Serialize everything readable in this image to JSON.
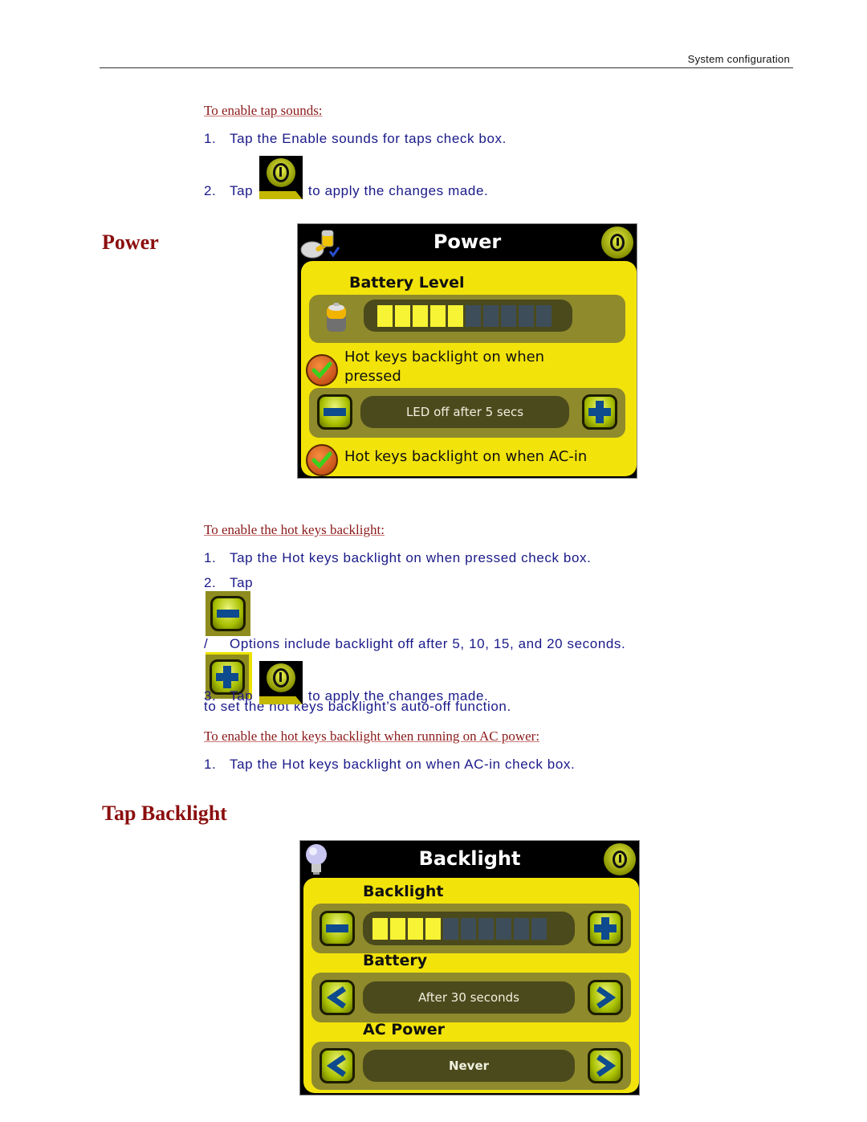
{
  "header": {
    "running_head": "System configuration"
  },
  "tap_sounds": {
    "subheading": "To enable tap sounds:",
    "steps": [
      {
        "num": "1.",
        "text": "Tap the Enable sounds for taps check box."
      },
      {
        "num": "2.",
        "pre": "Tap",
        "post": "to apply the changes made."
      }
    ]
  },
  "power_section": {
    "heading": "Power",
    "panel": {
      "title": "Power",
      "header_icon": "battery-plug-icon",
      "ok_icon": "power-ok-icon",
      "battery_level_label": "Battery Level",
      "battery_level": {
        "filled_segments": 5,
        "total_segments": 10
      },
      "hotkeys_pressed": {
        "label_line1": "Hot keys backlight on when",
        "label_line2": "pressed",
        "checked": true
      },
      "led_value": "LED off after 5 secs",
      "hotkeys_ac": {
        "label": "Hot keys backlight on when AC-in",
        "checked": true
      }
    }
  },
  "hotkeys": {
    "subheading": "To enable the hot keys backlight:",
    "steps": [
      {
        "num": "1.",
        "text": "Tap the Hot keys backlight on when pressed check box."
      },
      {
        "num": "2.",
        "pre": "Tap",
        "sep": "/",
        "post": "to set the hot keys backlight’s auto-off function.",
        "cont": "Options include backlight off after 5, 10, 15, and 20 seconds."
      },
      {
        "num": "3.",
        "pre": "Tap",
        "post": "to apply the changes made."
      }
    ]
  },
  "ac_power": {
    "subheading": "To enable the hot keys backlight when running on AC power:",
    "steps": [
      {
        "num": "1.",
        "text": "Tap the Hot keys backlight on when AC-in check box."
      }
    ]
  },
  "backlight_section": {
    "heading": "Tap Backlight",
    "panel": {
      "title": "Backlight",
      "header_icon": "light-bulb-icon",
      "backlight_label": "Backlight",
      "backlight_level": {
        "filled_segments": 4,
        "total_segments": 10
      },
      "battery_label": "Battery",
      "battery_value": "After 30 seconds",
      "ac_label": "AC Power",
      "ac_value": "Never"
    }
  }
}
